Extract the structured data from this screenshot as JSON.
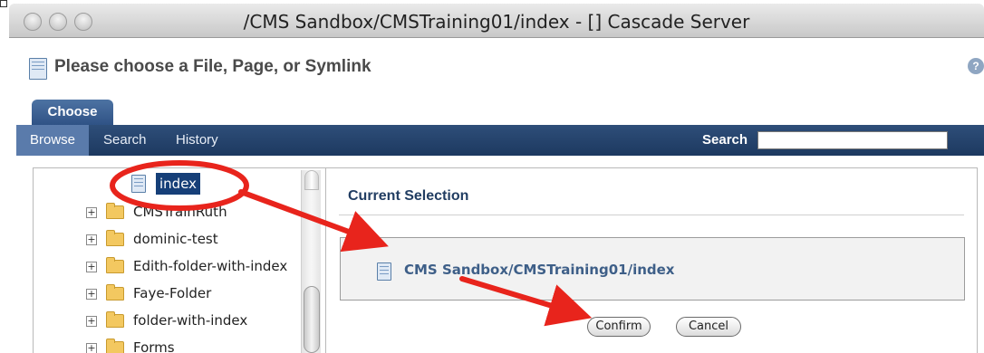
{
  "window": {
    "title": "/CMS Sandbox/CMSTraining01/index - [] Cascade Server"
  },
  "dialog": {
    "title": "Please choose a File, Page, or Symlink",
    "tab_label": "Choose"
  },
  "nav": {
    "items": [
      {
        "label": "Browse",
        "active": true
      },
      {
        "label": "Search",
        "active": false
      },
      {
        "label": "History",
        "active": false
      }
    ],
    "search_label": "Search",
    "search_value": ""
  },
  "tree": {
    "selected_item": "index",
    "items": [
      {
        "label": "CMSTrainRuth",
        "type": "folder"
      },
      {
        "label": "dominic-test",
        "type": "folder"
      },
      {
        "label": "Edith-folder-with-index",
        "type": "folder"
      },
      {
        "label": "Faye-Folder",
        "type": "folder"
      },
      {
        "label": "folder-with-index",
        "type": "folder"
      },
      {
        "label": "Forms",
        "type": "folder"
      }
    ]
  },
  "selection": {
    "heading": "Current Selection",
    "path": "CMS Sandbox/CMSTraining01/index"
  },
  "buttons": {
    "confirm": "Confirm",
    "cancel": "Cancel"
  },
  "icons": {
    "page": "page-icon",
    "folder": "folder-icon",
    "expand": "plus-expander-icon",
    "help": "help-icon"
  },
  "colors": {
    "nav_bg": "#1d3960",
    "selected_bg": "#163f78",
    "annotation_red": "#e8241c"
  }
}
